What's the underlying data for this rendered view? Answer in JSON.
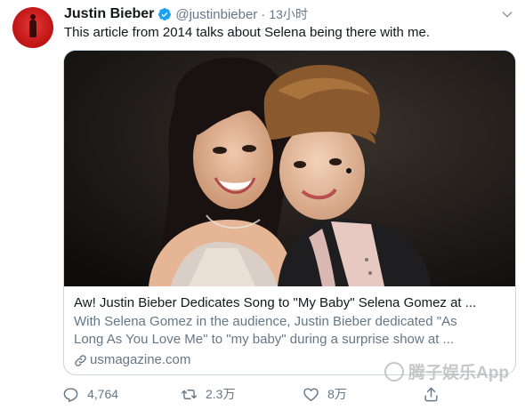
{
  "tweet": {
    "author_name": "Justin Bieber",
    "handle": "@justinbieber",
    "separator": "·",
    "time": "13小时",
    "text": "This article from 2014 talks about Selena being there with me."
  },
  "card": {
    "image_alt": "Photo of Selena Gomez and Justin Bieber",
    "title": "Aw! Justin Bieber Dedicates Song to \"My Baby\" Selena Gomez at ...",
    "description_line1": "With Selena Gomez in the audience, Justin Bieber dedicated \"As",
    "description_line2": "Long As You Love Me\" to \"my baby\" during a surprise show at ...",
    "domain": "usmagazine.com"
  },
  "actions": {
    "reply_count": "4,764",
    "retweet_count": "2.3万",
    "like_count": "8万"
  },
  "watermark": {
    "text": "腾子娱乐App"
  },
  "icons": {
    "verified": "verified-badge-icon",
    "more": "chevron-down-icon",
    "link": "link-icon",
    "reply": "reply-icon",
    "retweet": "retweet-icon",
    "like": "heart-icon",
    "share": "share-icon"
  },
  "colors": {
    "text_primary": "#14171a",
    "text_secondary": "#657786",
    "verified_blue": "#1da1f2",
    "card_border": "#ccd6dd",
    "avatar_red": "#c41717"
  }
}
